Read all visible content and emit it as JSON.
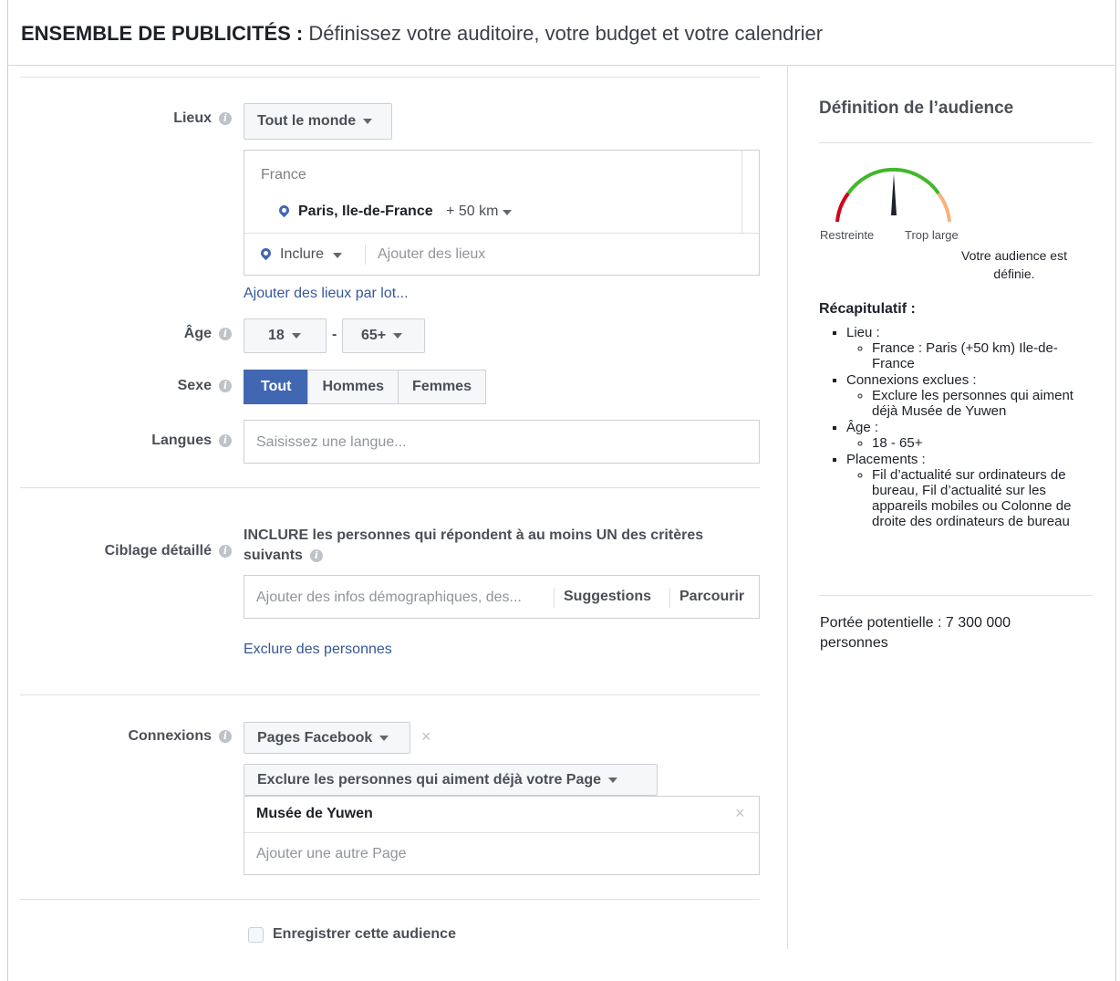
{
  "header": {
    "title_bold": "ENSEMBLE DE PUBLICITÉS :",
    "title_rest": "Définissez votre auditoire, votre budget et votre calendrier"
  },
  "locations": {
    "label": "Lieux",
    "scope_dropdown": "Tout le monde",
    "country": "France",
    "city": "Paris, Ile-de-France",
    "radius": "+ 50 km",
    "include_dropdown": "Inclure",
    "add_placeholder": "Ajouter des lieux",
    "bulk_link": "Ajouter des lieux par lot..."
  },
  "age": {
    "label": "Âge",
    "min": "18",
    "separator": "-",
    "max": "65+"
  },
  "gender": {
    "label": "Sexe",
    "options": [
      "Tout",
      "Hommes",
      "Femmes"
    ],
    "selected": "Tout"
  },
  "languages": {
    "label": "Langues",
    "placeholder": "Saisissez une langue..."
  },
  "detailed_targeting": {
    "label": "Ciblage détaillé",
    "description_line1": "INCLURE les personnes qui répondent à au moins UN des critères",
    "description_line2": "suivants",
    "placeholder": "Ajouter des infos démographiques, des...",
    "suggestions": "Suggestions",
    "browse": "Parcourir",
    "exclude_link": "Exclure des personnes"
  },
  "connections": {
    "label": "Connexions",
    "type_dropdown": "Pages Facebook",
    "exclude_dropdown": "Exclure les personnes qui aiment déjà votre Page",
    "selected_page": "Musée de Yuwen",
    "add_placeholder": "Ajouter une autre Page"
  },
  "save_audience": {
    "label": "Enregistrer cette audience",
    "checked": false
  },
  "sidebar": {
    "title": "Définition de l’audience",
    "gauge_left": "Restreinte",
    "gauge_right": "Trop large",
    "gauge_level": 0.5,
    "status_line1": "Votre audience est",
    "status_line2": "définie.",
    "recap_title": "Récapitulatif :",
    "recap": {
      "lieu": "Lieu :",
      "lieu_value": "France : Paris (+50 km) Ile-de-France",
      "connexions": "Connexions exclues :",
      "connexions_value": "Exclure les personnes qui aiment déjà Musée de Yuwen",
      "age": "Âge :",
      "age_value": "18 - 65+",
      "placements": "Placements :",
      "placements_value": "Fil d’actualité sur ordinateurs de bureau, Fil d’actualité sur les appareils mobiles ou Colonne de droite des ordinateurs de bureau"
    },
    "reach_line1": "Portée potentielle : 7 300 000",
    "reach_line2": "personnes"
  },
  "colors": {
    "accent": "#4267b2",
    "link": "#365899",
    "gauge_red": "#d0021b",
    "gauge_green": "#42b72a",
    "gauge_orange": "#f7b27d"
  }
}
